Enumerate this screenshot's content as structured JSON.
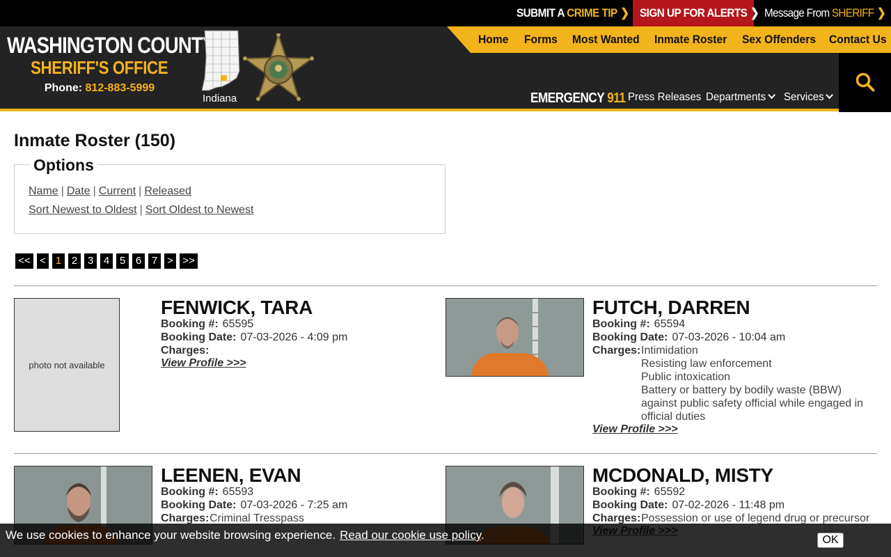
{
  "topbar": {
    "crime_tip_prefix": "SUBMIT A",
    "crime_tip_highlight": "CRIME TIP",
    "alerts": "SIGN UP FOR ALERTS",
    "message_prefix": "Message From",
    "message_highlight": "SHERIFF"
  },
  "brand": {
    "title": "WASHINGTON COUNTY",
    "subtitle": "SHERIFF'S OFFICE",
    "phone_label": "Phone:",
    "phone_number": "812-883-5999",
    "state_label": "Indiana"
  },
  "mainnav": [
    "Home",
    "Forms",
    "Most Wanted",
    "Inmate Roster",
    "Sex Offenders",
    "Contact Us"
  ],
  "emergency": {
    "label": "EMERGENCY",
    "number": "911"
  },
  "subnav": [
    {
      "label": "Press Releases"
    },
    {
      "label": "Departments"
    },
    {
      "label": "Services"
    }
  ],
  "page": {
    "title": "Inmate Roster (150)"
  },
  "options": {
    "legend": "Options",
    "filters": [
      "Name",
      "Date",
      "Current",
      "Released"
    ],
    "sorts": [
      "Sort Newest to Oldest",
      "Sort Oldest to Newest"
    ]
  },
  "pager": [
    "<<",
    "<",
    "1",
    "2",
    "3",
    "4",
    "5",
    "6",
    "7",
    ">",
    ">>"
  ],
  "labels": {
    "booking_no": "Booking #:",
    "booking_date": "Booking Date:",
    "charges": "Charges:",
    "view_profile": "View Profile >>>",
    "photo_na": "photo not available"
  },
  "inmates": [
    {
      "name": "FENWICK, TARA",
      "booking_no": "65595",
      "booking_date": "07-03-2026 - 4:09 pm",
      "charges": []
    },
    {
      "name": "FUTCH, DARREN",
      "booking_no": "65594",
      "booking_date": "07-03-2026 - 10:04 am",
      "charges": [
        "Intimidation",
        "Resisting law enforcement",
        "Public intoxication",
        "Battery or battery by bodily waste (BBW) against public safety official while engaged in official duties"
      ]
    },
    {
      "name": "LEENEN, EVAN",
      "booking_no": "65593",
      "booking_date": "07-03-2026 - 7:25 am",
      "charges": [
        "Criminal Tresspass"
      ]
    },
    {
      "name": "MCDONALD, MISTY",
      "booking_no": "65592",
      "booking_date": "07-02-2026 - 11:48 pm",
      "charges": [
        "Possession or use of legend drug or precursor"
      ]
    }
  ],
  "cookie": {
    "text": "We use cookies to enhance your website browsing experience.",
    "link": "Read our cookie use policy",
    "ok": "OK"
  },
  "colors": {
    "gold": "#f3b31b",
    "header": "#232323",
    "alert_red": "#b5161b"
  }
}
